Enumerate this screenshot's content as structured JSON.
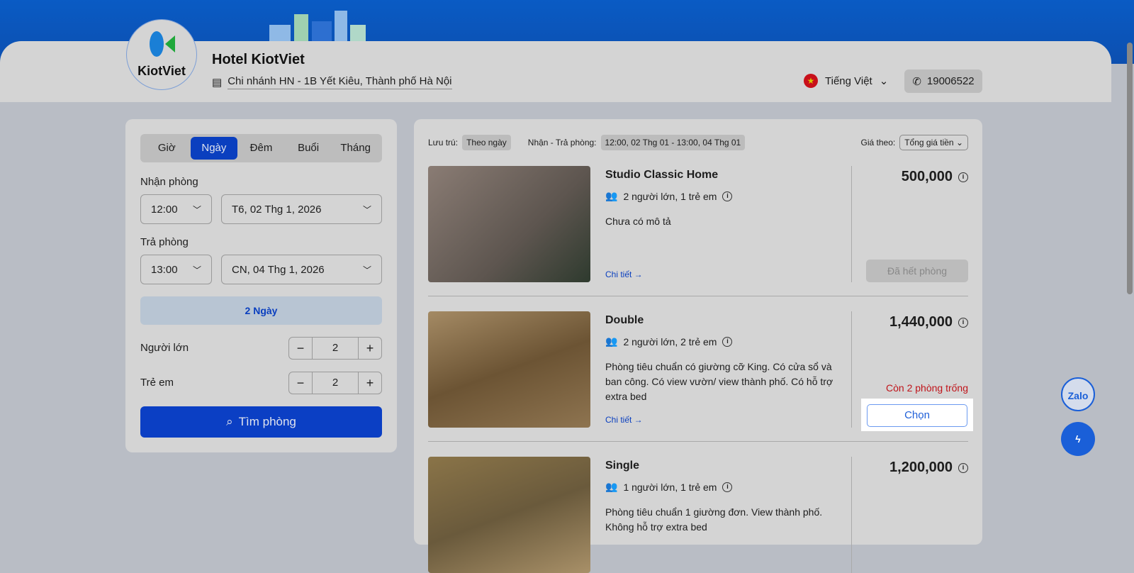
{
  "header": {
    "hotel_name": "Hotel KiotViet",
    "logo_text": "KiotViet",
    "branch": "Chi nhánh HN - 1B Yết Kiêu, Thành phố Hà Nội",
    "language": "Tiếng Việt",
    "phone": "19006522"
  },
  "search": {
    "tabs": [
      "Giờ",
      "Ngày",
      "Đêm",
      "Buổi",
      "Tháng"
    ],
    "active_tab": "Ngày",
    "checkin_label": "Nhận phòng",
    "checkin_time": "12:00",
    "checkin_date": "T6, 02 Thg 1, 2026",
    "checkout_label": "Trả phòng",
    "checkout_time": "13:00",
    "checkout_date": "CN, 04 Thg 1, 2026",
    "duration": "2 Ngày",
    "adults_label": "Người lớn",
    "adults": "2",
    "children_label": "Trẻ em",
    "children": "2",
    "search_button": "Tìm phòng"
  },
  "filters": {
    "stay_label": "Lưu trú:",
    "stay_value": "Theo ngày",
    "period_label": "Nhận - Trả phòng:",
    "period_value": "12:00, 02 Thg 01 - 13:00, 04 Thg 01",
    "price_label": "Giá theo:",
    "price_value": "Tổng giá tiền"
  },
  "rooms": [
    {
      "name": "Studio Classic Home",
      "capacity": "2 người lớn, 1 trẻ em",
      "description": "Chưa có mô tả",
      "detail": "Chi tiết →",
      "price": "500,000",
      "status": "Đã hết phòng"
    },
    {
      "name": "Double",
      "capacity": "2 người lớn, 2 trẻ em",
      "description": "Phòng tiêu chuẩn có giường cỡ King. Có cửa sổ và ban công. Có view vườn/ view thành phố. Có hỗ trợ extra bed",
      "detail": "Chi tiết →",
      "price": "1,440,000",
      "availability": "Còn 2 phòng trống",
      "action": "Chọn"
    },
    {
      "name": "Single",
      "capacity": "1 người lớn, 1 trẻ em",
      "description": "Phòng tiêu chuẩn 1 giường đơn. View thành phố. Không hỗ trợ extra bed",
      "price": "1,200,000"
    }
  ],
  "floating": {
    "zalo": "Zalo"
  }
}
